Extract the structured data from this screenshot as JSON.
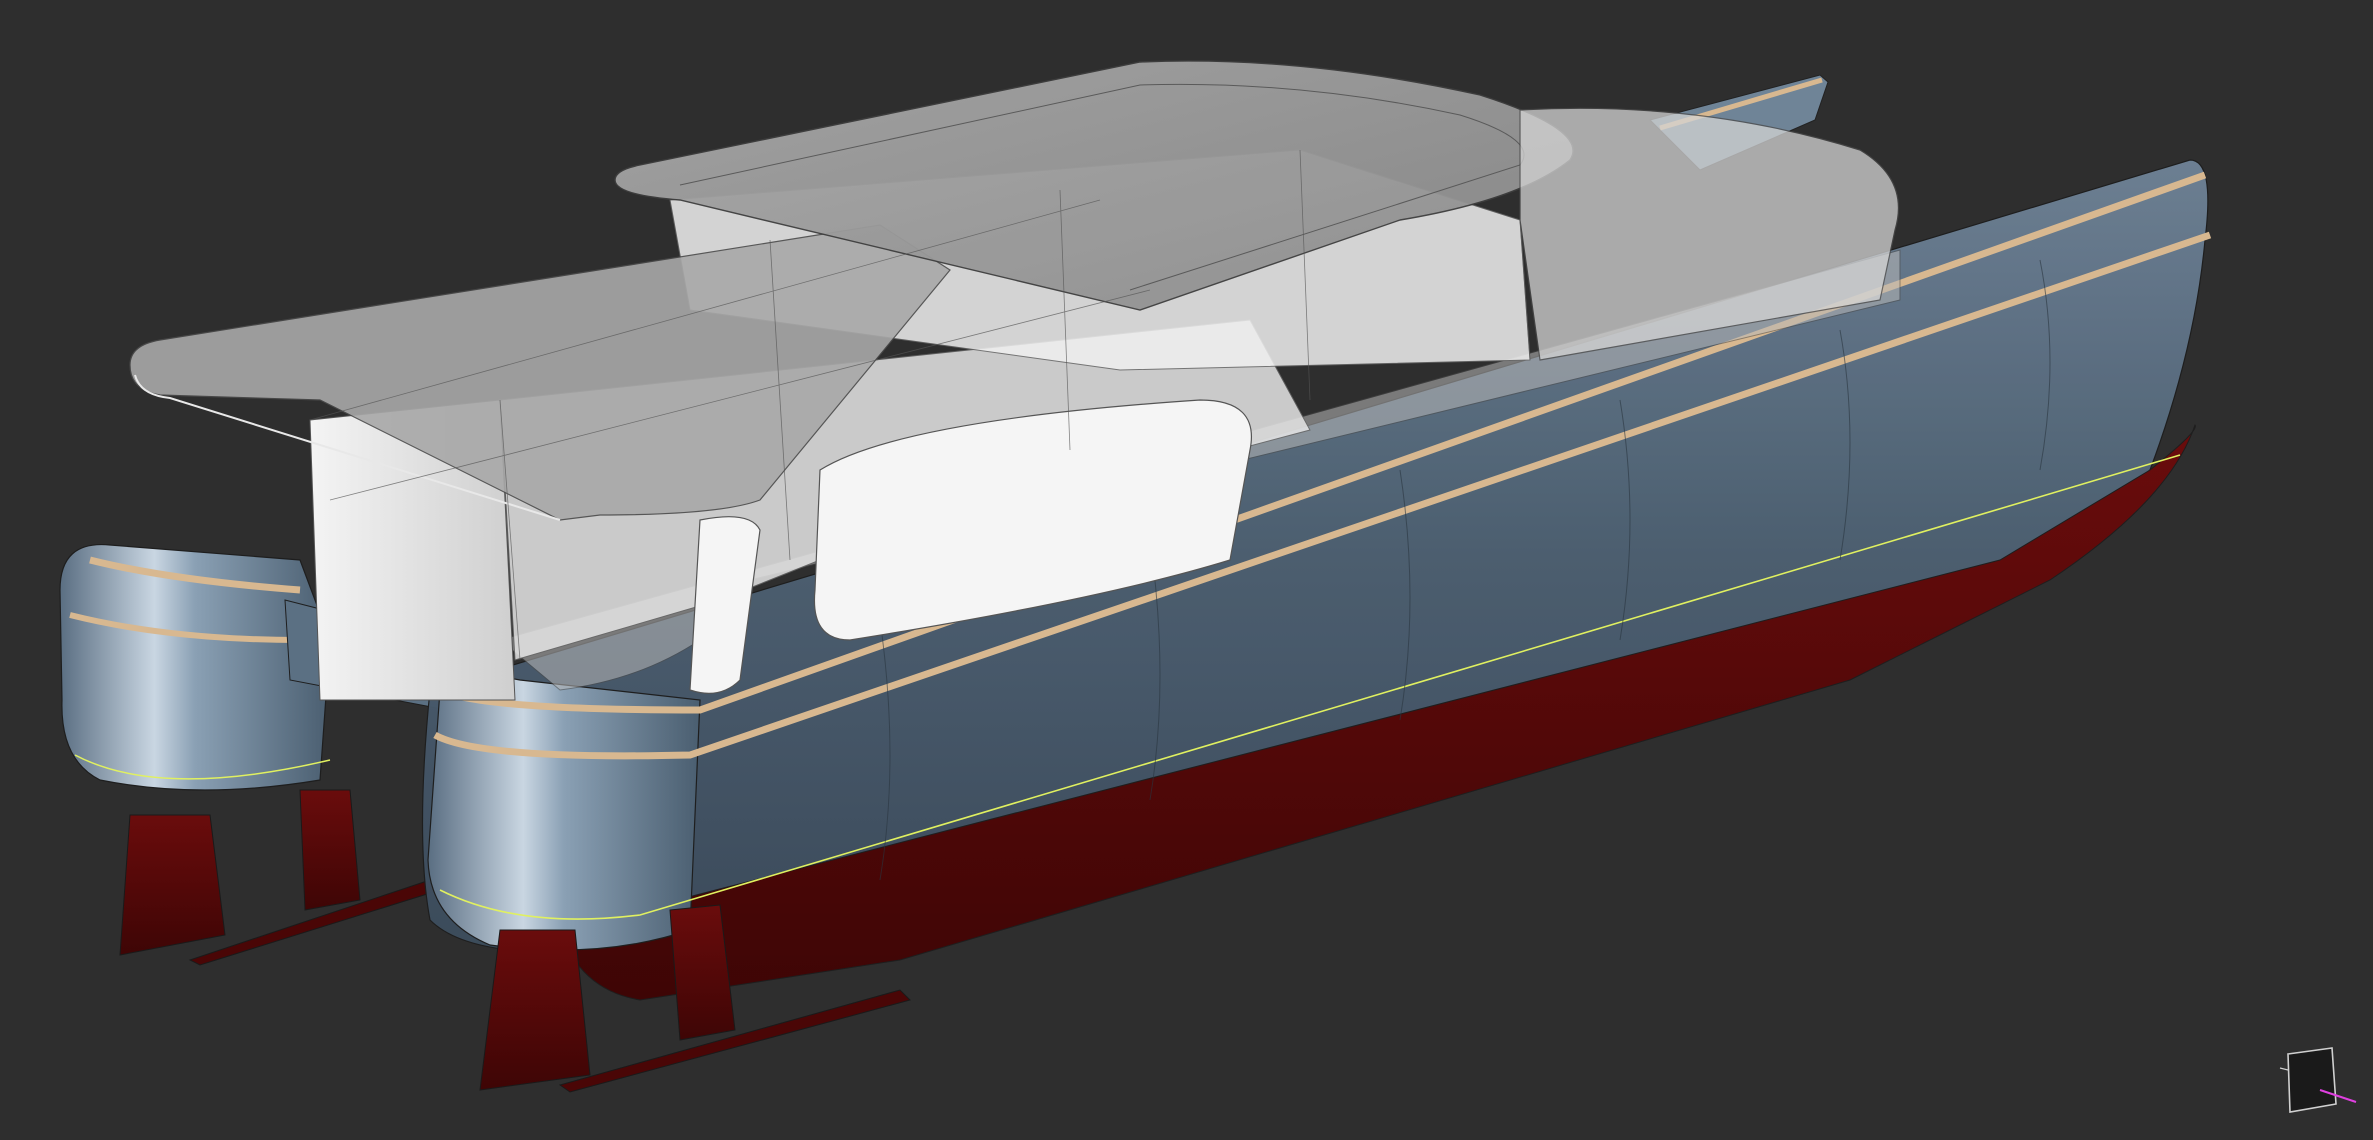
{
  "viewport": {
    "background": "#2e2e2e"
  },
  "model": {
    "hull_color": "#4e6275",
    "antifouling_color": "#5a0a0a",
    "rubrail_color": "#d8b890",
    "waterline_color": "#e0f060",
    "superstructure_color": "#c8c8c8"
  },
  "view_cube": {
    "icon": "orientation-cube-icon",
    "axis_color": "#e040e0"
  }
}
